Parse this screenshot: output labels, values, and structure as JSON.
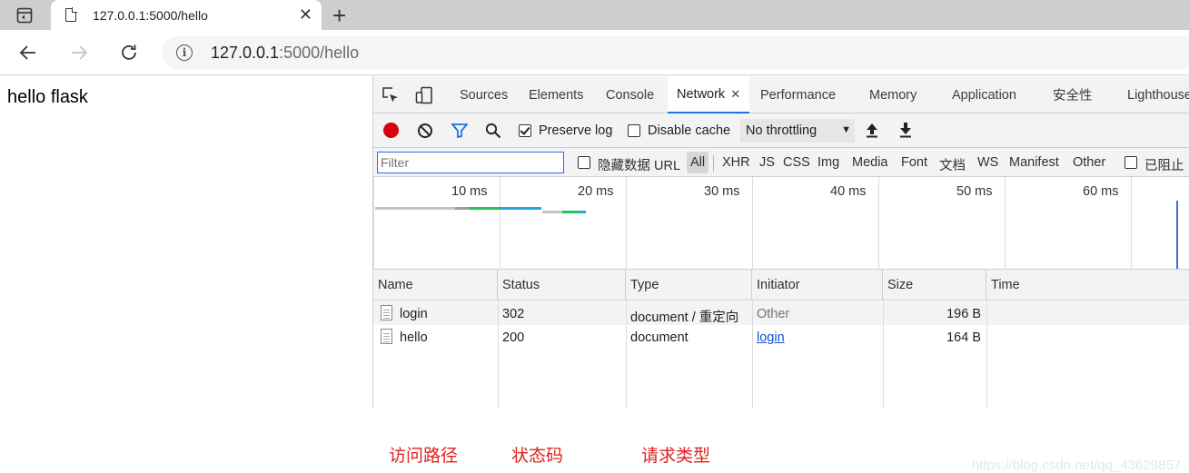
{
  "browser": {
    "tab": {
      "title": "127.0.0.1:5000/hello"
    },
    "address": {
      "host": "127.0.0.1",
      "path": ":5000/hello"
    }
  },
  "page": {
    "text": "hello flask"
  },
  "devtools": {
    "tabs": [
      {
        "label": "Sources"
      },
      {
        "label": "Elements"
      },
      {
        "label": "Console"
      },
      {
        "label": "Network",
        "active": true
      },
      {
        "label": "Performance"
      },
      {
        "label": "Memory"
      },
      {
        "label": "Application"
      },
      {
        "label": "安全性"
      },
      {
        "label": "Lighthouse"
      }
    ],
    "toolbar": {
      "preserve_log": {
        "label": "Preserve log",
        "checked": true
      },
      "disable_cache": {
        "label": "Disable cache",
        "checked": false
      },
      "throttling": "No throttling"
    },
    "filterbar": {
      "placeholder": "Filter",
      "hide_data_url": "隐藏数据 URL",
      "types": [
        "All",
        "XHR",
        "JS",
        "CSS",
        "Img",
        "Media",
        "Font",
        "文档",
        "WS",
        "Manifest",
        "Other"
      ],
      "active_type": "All",
      "blocked": "已阻止"
    },
    "overview": {
      "ticks": [
        "10 ms",
        "20 ms",
        "30 ms",
        "40 ms",
        "50 ms",
        "60 ms"
      ]
    },
    "table": {
      "columns": [
        "Name",
        "Status",
        "Type",
        "Initiator",
        "Size",
        "Time"
      ],
      "rows": [
        {
          "name": "login",
          "status": "302",
          "type": "document / 重定向",
          "initiator": "Other",
          "size": "196 B",
          "time": ""
        },
        {
          "name": "hello",
          "status": "200",
          "type": "document",
          "initiator": "login",
          "size": "164 B",
          "time": ""
        }
      ]
    },
    "annotations": [
      "访问路径",
      "状态码",
      "请求类型"
    ]
  },
  "watermark": "https://blog.csdn.net/qq_43629857",
  "colors": {
    "record": "#d9000f",
    "accent": "#1a73e8",
    "annotation": "#e02020"
  }
}
